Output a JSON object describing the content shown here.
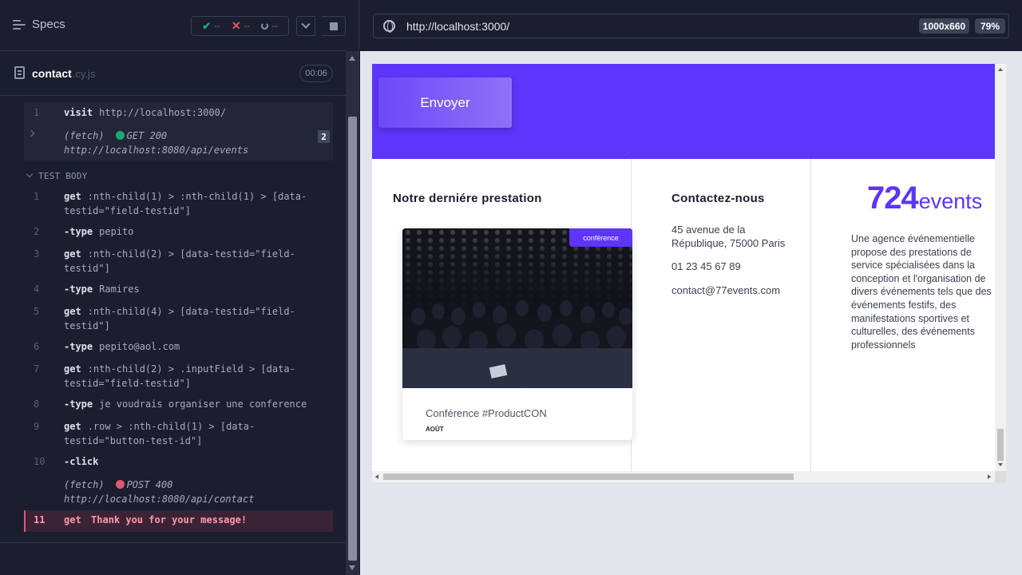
{
  "runner": {
    "specs_label": "Specs",
    "stats": {
      "passed": "--",
      "failed": "--",
      "pending": "--"
    },
    "file": {
      "name": "contact",
      "ext": ".cy.js",
      "duration": "00:06"
    },
    "hook": {
      "number": "1",
      "visit_name": "visit",
      "visit_msg": "http://localhost:3000/",
      "fetch_label": "(fetch)",
      "fetch_method": "GET 200",
      "fetch_url": "http://localhost:8080/api/events",
      "fetch_count": "2"
    },
    "section_label": "TEST BODY",
    "commands": [
      {
        "num": "1",
        "name": "get",
        "msg": ":nth-child(1) > :nth-child(1) > [data-testid=\"field-testid\"]"
      },
      {
        "num": "2",
        "name": "-type",
        "msg": "pepito"
      },
      {
        "num": "3",
        "name": "get",
        "msg": ":nth-child(2) > [data-testid=\"field-testid\"]"
      },
      {
        "num": "4",
        "name": "-type",
        "msg": "Ramires"
      },
      {
        "num": "5",
        "name": "get",
        "msg": ":nth-child(4) > [data-testid=\"field-testid\"]"
      },
      {
        "num": "6",
        "name": "-type",
        "msg": "pepito@aol.com"
      },
      {
        "num": "7",
        "name": "get",
        "msg": ":nth-child(2) > .inputField > [data-testid=\"field-testid\"]"
      },
      {
        "num": "8",
        "name": "-type",
        "msg": "je voudrais organiser une conference"
      },
      {
        "num": "9",
        "name": "get",
        "msg": ".row > :nth-child(1) > [data-testid=\"button-test-id\"]"
      },
      {
        "num": "10",
        "name": "-click",
        "msg": ""
      }
    ],
    "post_fetch": {
      "label": "(fetch)",
      "method": "POST 400",
      "url": "http://localhost:8080/api/contact"
    },
    "error_cmd": {
      "num": "11",
      "name": "get",
      "msg": "Thank you for your message!"
    }
  },
  "aut": {
    "url": "http://localhost:3000/",
    "viewport": "1000x660",
    "zoom": "79%",
    "page": {
      "send_button": "Envoyer",
      "last_work_title": "Notre derniére prestation",
      "card": {
        "tag": "conférence",
        "title": "Conférence #ProductCON",
        "date": "AOÛT"
      },
      "contact_title": "Contactez-nous",
      "address_line1": "45 avenue de la",
      "address_line2": "République, 75000 Paris",
      "phone": "01 23 45 67 89",
      "email": "contact@77events.com",
      "logo_digits": "724",
      "logo_word": "events",
      "about_lines": [
        "Une agence événementielle",
        "propose des prestations de",
        "service spécialisées dans la",
        "conception et l'organisation de",
        "divers événements tels que des",
        "événements festifs, des",
        "manifestations sportives et",
        "culturelles, des événements",
        "professionnels"
      ]
    }
  },
  "colors": {
    "accent": "#5d35fb",
    "pass": "#1fa971",
    "fail": "#e45770"
  }
}
